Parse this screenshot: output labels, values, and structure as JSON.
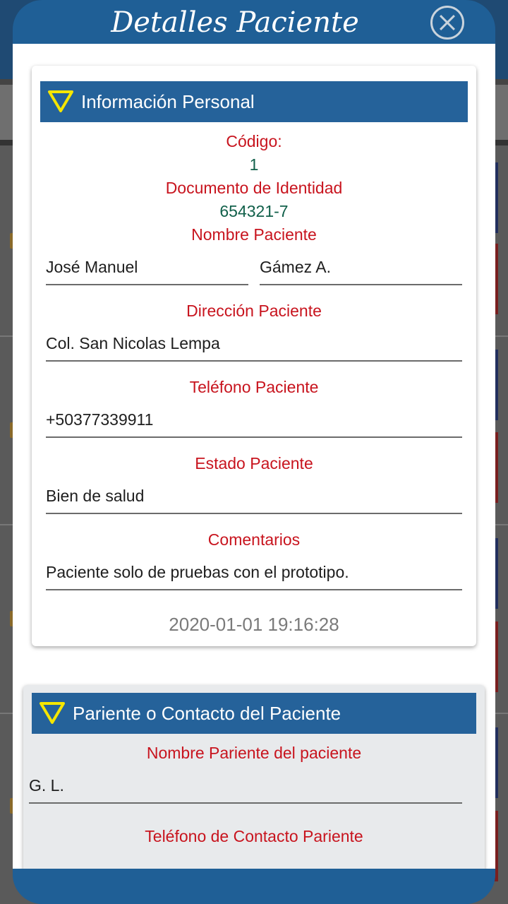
{
  "dialog": {
    "title": "Detalles Paciente",
    "close_icon": "close-circle-icon"
  },
  "personal": {
    "section_title": "Información Personal",
    "codigo_label": "Código:",
    "codigo_value": "1",
    "documento_label": "Documento de Identidad",
    "documento_value": "654321-7",
    "nombre_label": "Nombre Paciente",
    "first_name": "José Manuel",
    "last_name": "Gámez A.",
    "direccion_label": "Dirección Paciente",
    "direccion_value": "Col. San Nicolas Lempa",
    "telefono_label": "Teléfono Paciente",
    "telefono_value": "+50377339911",
    "estado_label": "Estado Paciente",
    "estado_value": "Bien de salud",
    "comentarios_label": "Comentarios",
    "comentarios_value": "Paciente solo de pruebas con el prototipo.",
    "timestamp": "2020-01-01 19:16:28"
  },
  "contact": {
    "section_title": "Pariente o Contacto del Paciente",
    "nombre_label": "Nombre Pariente del paciente",
    "nombre_value": "G. L.",
    "telefono_label": "Teléfono de Contacto Pariente"
  },
  "colors": {
    "header_blue": "#25629a",
    "label_red": "#c8141e",
    "value_green": "#11604a",
    "triangle_yellow": "#f5e600"
  }
}
